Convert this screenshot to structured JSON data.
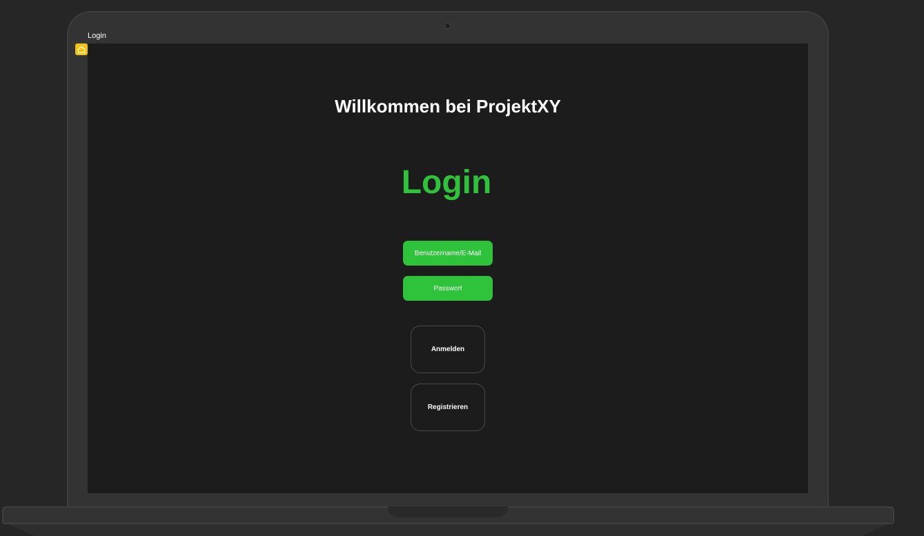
{
  "window": {
    "title": "Login"
  },
  "icons": {
    "home": "home-icon"
  },
  "colors": {
    "accent": "#2fc23b",
    "screen_bg": "#1c1c1c",
    "home_badge": "#f2c40f"
  },
  "page": {
    "welcome": "Willkommen bei ProjektXY",
    "heading": "Login"
  },
  "form": {
    "username_placeholder": "Benutzername/E-Mail",
    "password_placeholder": "Passwort",
    "login_button": "Anmelden",
    "register_button": "Registrieren"
  }
}
